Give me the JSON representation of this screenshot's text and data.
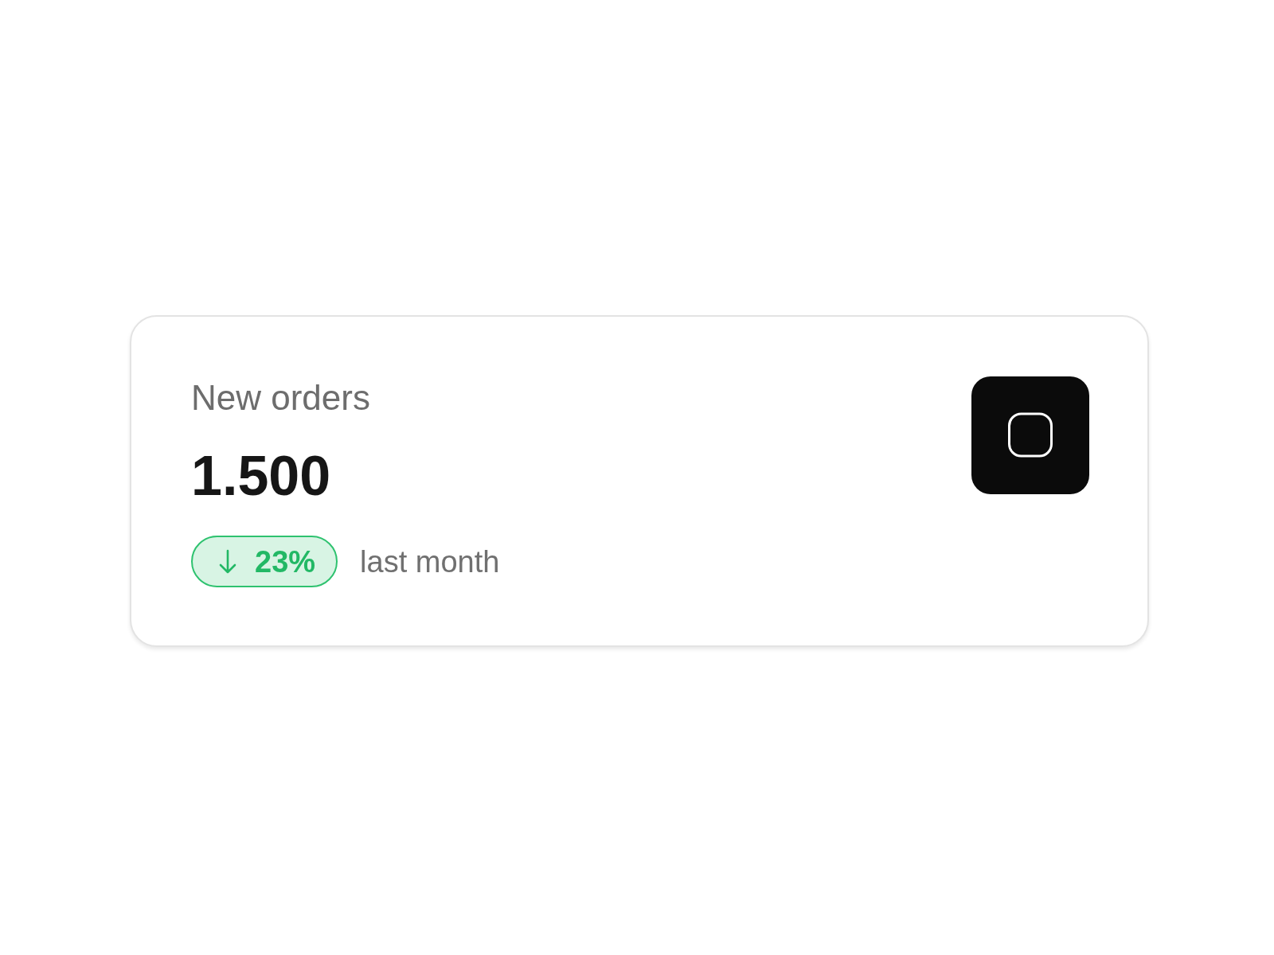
{
  "card": {
    "title": "New orders",
    "value": "1.500",
    "change": {
      "decrease": true,
      "text": "23%"
    },
    "comparison": "last month"
  }
}
